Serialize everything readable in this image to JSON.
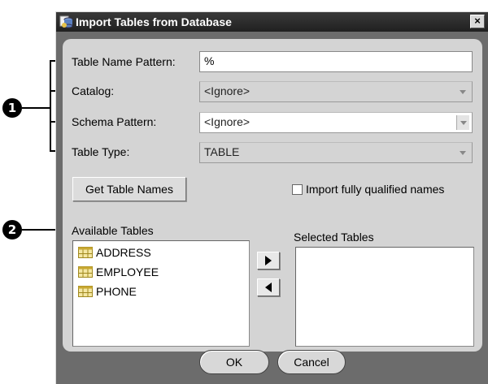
{
  "window": {
    "title": "Import Tables from Database",
    "close_glyph": "×"
  },
  "callouts": {
    "one": "1",
    "two": "2"
  },
  "form": {
    "table_name_pattern": {
      "label": "Table Name Pattern:",
      "value": "%"
    },
    "catalog": {
      "label": "Catalog:",
      "value": "<Ignore>"
    },
    "schema_pattern": {
      "label": "Schema Pattern:",
      "value": "<Ignore>"
    },
    "table_type": {
      "label": "Table Type:",
      "value": "TABLE"
    }
  },
  "get_table_names_label": "Get Table Names",
  "import_fq": {
    "label": "Import fully qualified names",
    "checked": false
  },
  "available": {
    "heading": "Available Tables",
    "items": [
      "ADDRESS",
      "EMPLOYEE",
      "PHONE"
    ]
  },
  "selected": {
    "heading": "Selected Tables",
    "items": []
  },
  "buttons": {
    "ok": "OK",
    "cancel": "Cancel"
  },
  "icons": {
    "add": "right-arrow-icon",
    "remove": "left-arrow-icon",
    "table": "table-icon",
    "app": "database-app-icon"
  }
}
